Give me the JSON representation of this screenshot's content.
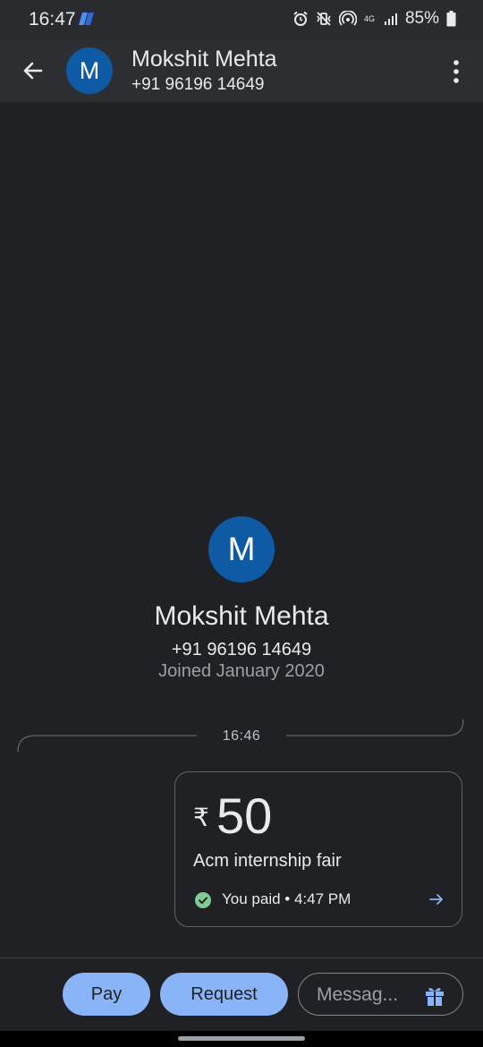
{
  "status_bar": {
    "time": "16:47",
    "network": "4G",
    "battery": "85%"
  },
  "header": {
    "avatar_letter": "M",
    "name": "Mokshit Mehta",
    "phone": "+91 96196 14649"
  },
  "profile": {
    "avatar_letter": "M",
    "name": "Mokshit Mehta",
    "phone": "+91 96196 14649",
    "joined": "Joined January 2020"
  },
  "divider": {
    "time": "16:46"
  },
  "payment": {
    "currency": "₹",
    "amount": "50",
    "note": "Acm internship fair",
    "status": "You paid • 4:47 PM"
  },
  "bottom": {
    "pay_label": "Pay",
    "request_label": "Request",
    "message_placeholder": "Messag..."
  },
  "colors": {
    "background": "#202124",
    "accent": "#8ab4f8",
    "avatar": "#0f5aa5",
    "success": "#81c995"
  }
}
